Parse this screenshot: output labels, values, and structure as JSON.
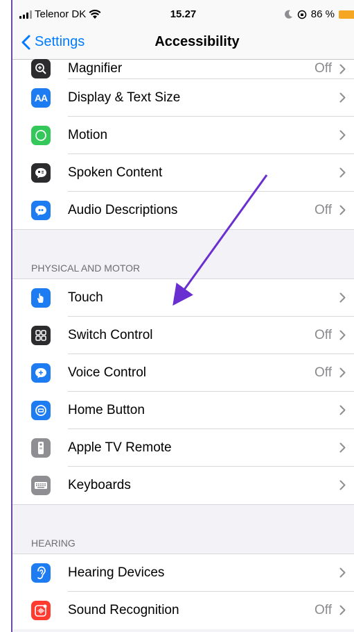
{
  "status_bar": {
    "carrier": "Telenor DK",
    "time": "15.27",
    "battery": "86 %"
  },
  "nav": {
    "back_label": "Settings",
    "title": "Accessibility"
  },
  "vision_items": [
    {
      "label": "Magnifier",
      "value": "Off",
      "icon": "magnifier-icon",
      "color": "#2c2c2e"
    },
    {
      "label": "Display & Text Size",
      "value": "",
      "icon": "display-text-size-icon",
      "color": "#1e7cf2"
    },
    {
      "label": "Motion",
      "value": "",
      "icon": "motion-icon",
      "color": "#34c759"
    },
    {
      "label": "Spoken Content",
      "value": "",
      "icon": "spoken-content-icon",
      "color": "#2c2c2e"
    },
    {
      "label": "Audio Descriptions",
      "value": "Off",
      "icon": "audio-descriptions-icon",
      "color": "#1e7cf2"
    }
  ],
  "sections": {
    "physical_motor": "PHYSICAL AND MOTOR",
    "hearing": "HEARING"
  },
  "physical_items": [
    {
      "label": "Touch",
      "value": "",
      "icon": "touch-icon",
      "color": "#1e7cf2"
    },
    {
      "label": "Switch Control",
      "value": "Off",
      "icon": "switch-control-icon",
      "color": "#2c2c2e"
    },
    {
      "label": "Voice Control",
      "value": "Off",
      "icon": "voice-control-icon",
      "color": "#1e7cf2"
    },
    {
      "label": "Home Button",
      "value": "",
      "icon": "home-button-icon",
      "color": "#1e7cf2"
    },
    {
      "label": "Apple TV Remote",
      "value": "",
      "icon": "apple-tv-remote-icon",
      "color": "#8e8e93"
    },
    {
      "label": "Keyboards",
      "value": "",
      "icon": "keyboard-icon",
      "color": "#8e8e93"
    }
  ],
  "hearing_items": [
    {
      "label": "Hearing Devices",
      "value": "",
      "icon": "ear-icon",
      "color": "#1e7cf2"
    },
    {
      "label": "Sound Recognition",
      "value": "Off",
      "icon": "sound-recognition-icon",
      "color": "#ff3b30"
    }
  ],
  "annotation": {
    "color": "#6a2fd0"
  }
}
